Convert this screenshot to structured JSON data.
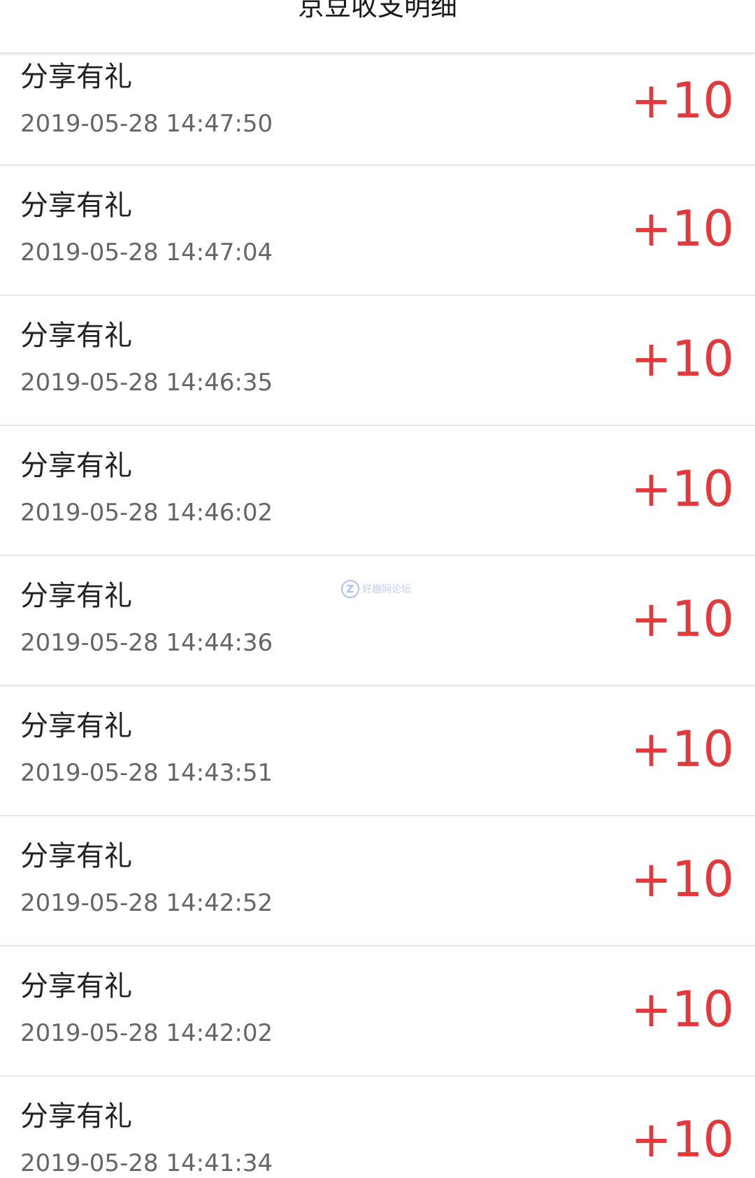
{
  "header": {
    "title": "京豆收支明细"
  },
  "colors": {
    "amount": "#e4393c",
    "title_text": "#222222",
    "time_text": "#666666",
    "divider": "#e6e6e6"
  },
  "records": [
    {
      "label": "分享有礼",
      "time": "2019-05-28 14:47:50",
      "amount": "+10"
    },
    {
      "label": "分享有礼",
      "time": "2019-05-28 14:47:04",
      "amount": "+10"
    },
    {
      "label": "分享有礼",
      "time": "2019-05-28 14:46:35",
      "amount": "+10"
    },
    {
      "label": "分享有礼",
      "time": "2019-05-28 14:46:02",
      "amount": "+10"
    },
    {
      "label": "分享有礼",
      "time": "2019-05-28 14:44:36",
      "amount": "+10"
    },
    {
      "label": "分享有礼",
      "time": "2019-05-28 14:43:51",
      "amount": "+10"
    },
    {
      "label": "分享有礼",
      "time": "2019-05-28 14:42:52",
      "amount": "+10"
    },
    {
      "label": "分享有礼",
      "time": "2019-05-28 14:42:02",
      "amount": "+10"
    },
    {
      "label": "分享有礼",
      "time": "2019-05-28 14:41:34",
      "amount": "+10"
    }
  ],
  "watermark": {
    "icon_name": "forum-logo-icon",
    "icon_glyph": "Z",
    "text": "好趣网论坛"
  }
}
